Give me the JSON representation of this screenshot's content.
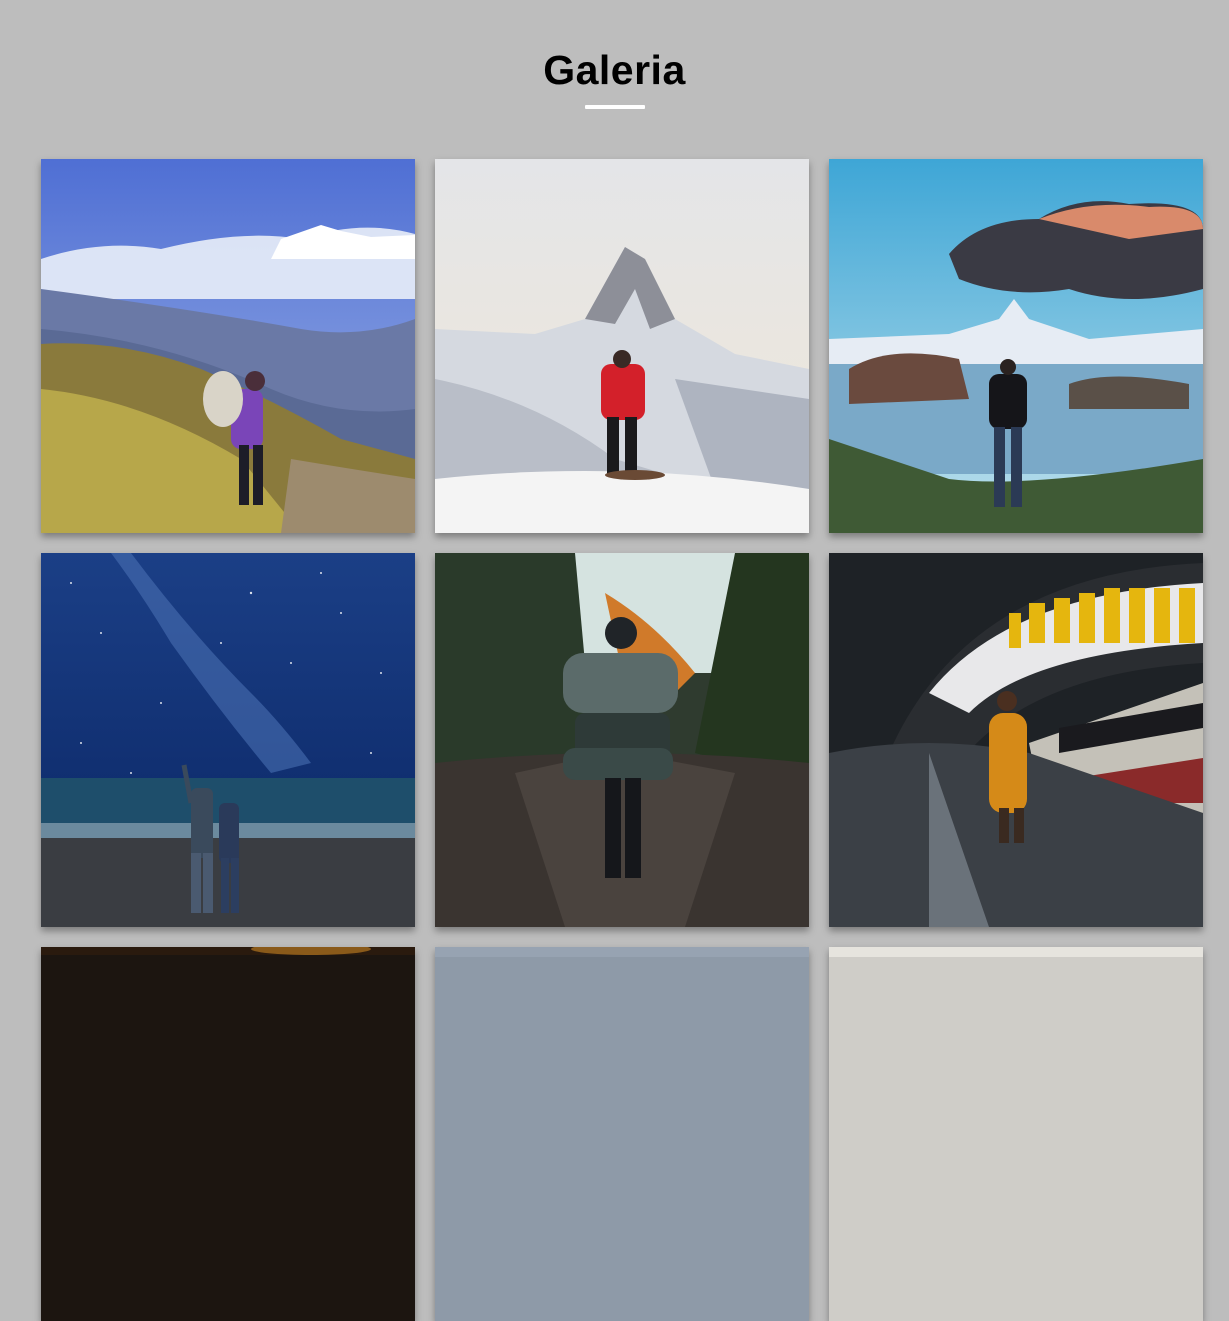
{
  "gallery": {
    "title": "Galeria",
    "images": [
      {
        "subject": "hiker-himalaya-photo"
      },
      {
        "subject": "red-jacket-matterhorn-photo"
      },
      {
        "subject": "lake-reflection-matterhorn-photo"
      },
      {
        "subject": "stargazing-beach-photo"
      },
      {
        "subject": "backpacker-forest-trail-photo"
      },
      {
        "subject": "monk-train-station-photo"
      },
      {
        "subject": "photo-row3-left"
      },
      {
        "subject": "photo-row3-middle"
      },
      {
        "subject": "photo-row3-right"
      }
    ]
  },
  "colors": {
    "page_background": "#bdbdbd",
    "title_color": "#000000",
    "underline_color": "#ffffff"
  }
}
